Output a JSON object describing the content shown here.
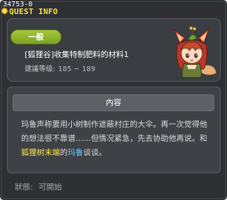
{
  "window": {
    "quest_id": "34753-0",
    "title": "QUEST INFO"
  },
  "quest": {
    "category": "一般",
    "name": "[狐狸谷]收集特制肥料的材料1",
    "level_label": "建議等级:",
    "level_range": "185 ~ 189"
  },
  "content": {
    "header": "內容",
    "text_before": "玛鲁声称要用小树制作遮蔽村庄的大伞。再一次觉得他的想法很不靠谱……但情况紧急，先去协助他再说。和",
    "highlight_item": "狐狸树末端",
    "text_middle": "的",
    "highlight_npc": "玛鲁",
    "text_after": "谈谈。"
  },
  "status": {
    "label": "狀態:",
    "value": "可開始"
  },
  "colors": {
    "title": "#f2e54a",
    "category_badge": "#8db52c",
    "highlight_item": "#ffe94c",
    "highlight_npc": "#6fc9ff"
  },
  "icons": {
    "title_icon": "quest-bulb-icon",
    "npc_portrait": "fox-girl-npc-portrait"
  }
}
